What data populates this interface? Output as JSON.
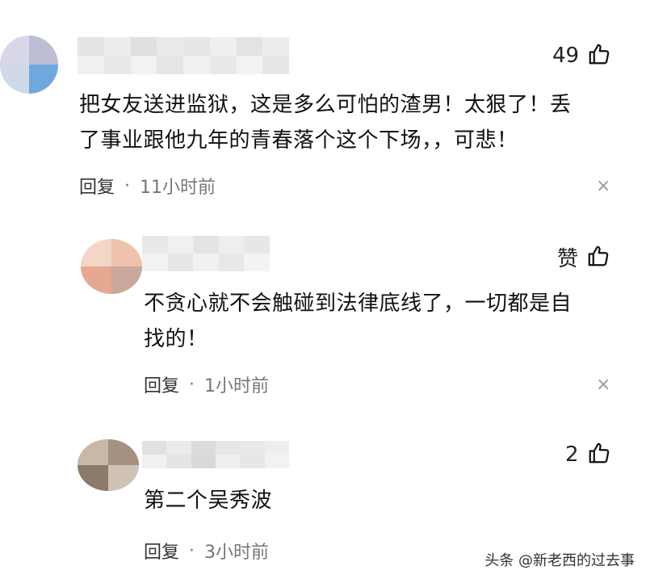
{
  "comments": [
    {
      "likes": "49",
      "text_line1": "把女友送进监狱，这是多么可怕的渣男！太狠了！丢",
      "text_line2": "了事业跟他九年的青春落个这个下场，，可悲！",
      "reply_label": "回复",
      "separator": "·",
      "time": "11小时前",
      "close": "×"
    },
    {
      "likes": "赞",
      "text_line1": "不贪心就不会触碰到法律底线了，一切都是自",
      "text_line2": "找的！",
      "reply_label": "回复",
      "separator": "·",
      "time": "1小时前",
      "close": "×"
    },
    {
      "likes": "2",
      "text_line1": "第二个吴秀波",
      "reply_label": "回复",
      "separator": "·",
      "time": "3小时前"
    }
  ],
  "watermark": "头条 @新老西的过去事",
  "icons": {
    "like": "thumbs-up-icon",
    "close": "close-icon"
  }
}
